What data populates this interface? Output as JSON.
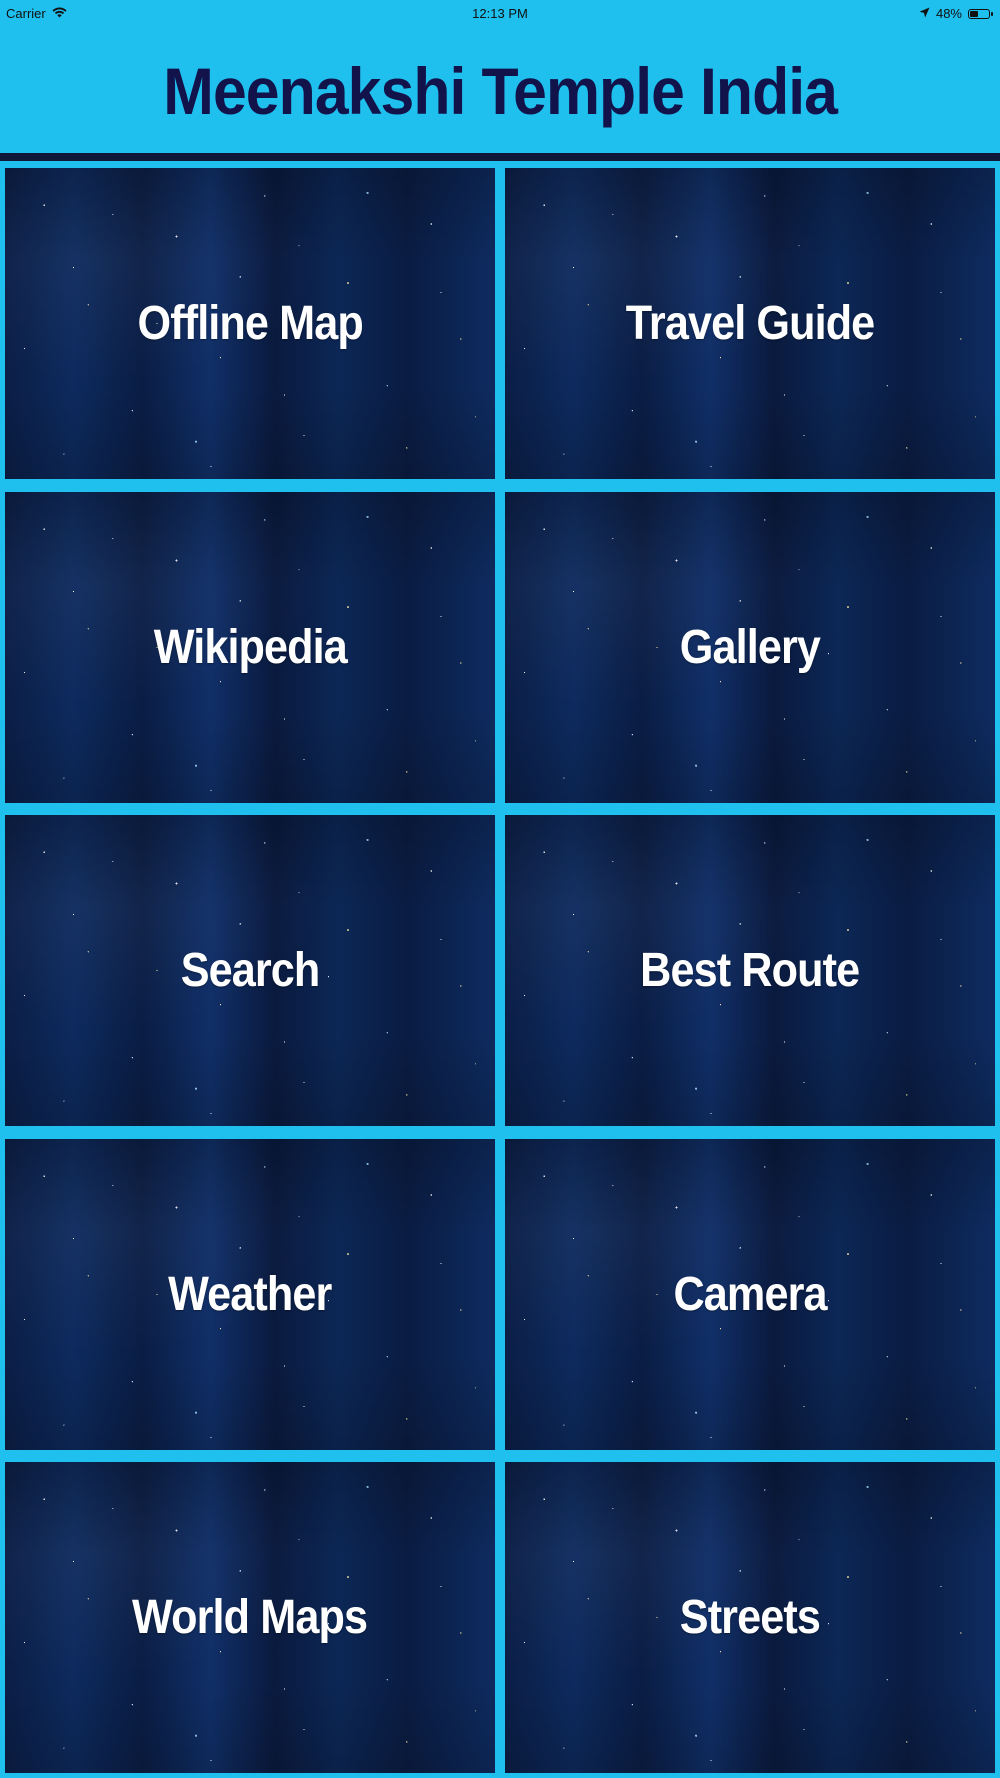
{
  "status_bar": {
    "carrier": "Carrier",
    "time": "12:13 PM",
    "battery_percent": "48%",
    "battery_level": 0.48,
    "icons": [
      "wifi-icon",
      "location-arrow-icon",
      "battery-icon"
    ]
  },
  "header": {
    "title": "Meenakshi Temple India"
  },
  "colors": {
    "header_background": "#1fbfee",
    "title_color": "#12134a",
    "divider_color": "#10183a",
    "tile_label_color": "#ffffff"
  },
  "menu": {
    "items": [
      {
        "label": "Offline Map"
      },
      {
        "label": "Travel Guide"
      },
      {
        "label": "Wikipedia"
      },
      {
        "label": "Gallery"
      },
      {
        "label": "Search"
      },
      {
        "label": "Best Route"
      },
      {
        "label": "Weather"
      },
      {
        "label": "Camera"
      },
      {
        "label": "World Maps"
      },
      {
        "label": "Streets"
      }
    ]
  }
}
